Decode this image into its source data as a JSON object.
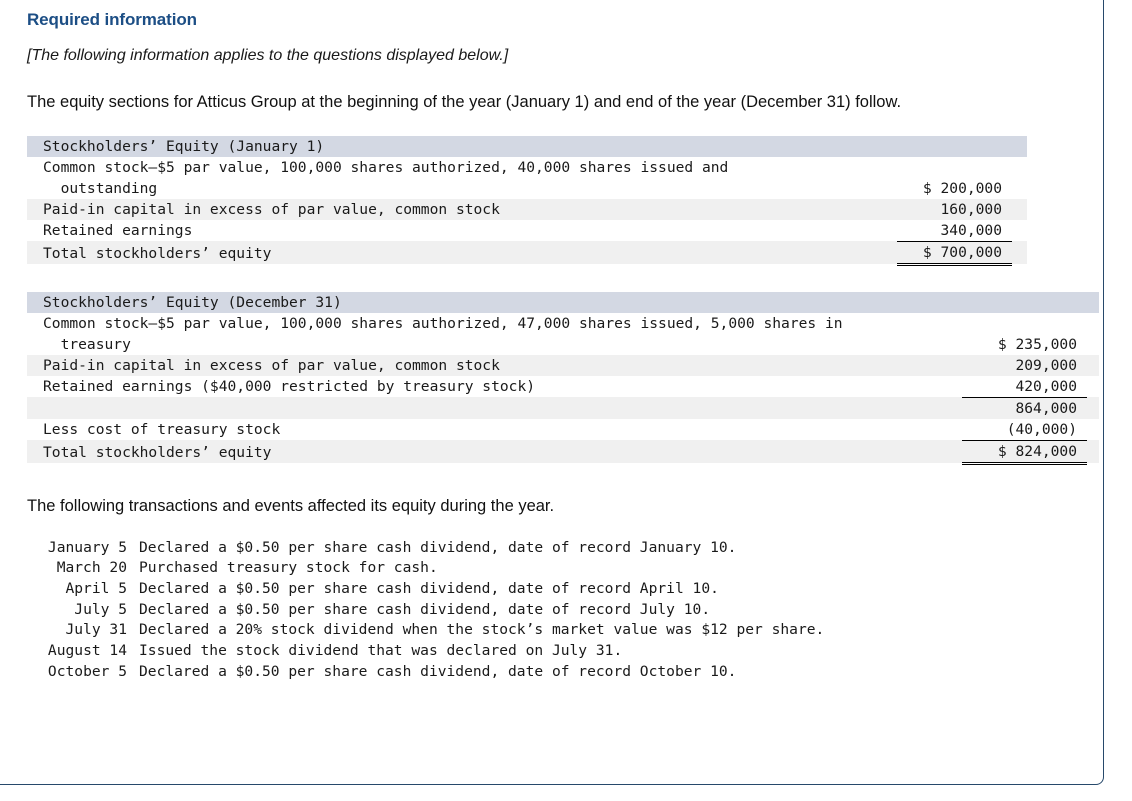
{
  "heading": "Required information",
  "italic_note": "[The following information applies to the questions displayed below.]",
  "intro_paragraph": "The equity sections for Atticus Group at the beginning of the year (January 1) and end of the year (December 31) follow.",
  "closing_paragraph": "The following transactions and events affected its equity during the year.",
  "colors": {
    "heading_blue": "#1c4e85",
    "table_header_band": "#d3d8e3",
    "row_shade": "#f0f0f0",
    "card_border": "#27496b"
  },
  "table_january": {
    "header": "Stockholders’ Equity (January 1)",
    "rows": [
      {
        "label": "Common stock—$5 par value, 100,000 shares authorized, 40,000 shares issued and",
        "value": ""
      },
      {
        "label": "  outstanding",
        "value": "$ 200,000"
      },
      {
        "label": "Paid-in capital in excess of par value, common stock",
        "value": "160,000"
      },
      {
        "label": "Retained earnings",
        "value": "340,000"
      },
      {
        "label": "Total stockholders’ equity",
        "value": "$ 700,000"
      }
    ]
  },
  "table_december": {
    "header": "Stockholders’ Equity (December 31)",
    "rows": [
      {
        "label": "Common stock—$5 par value, 100,000 shares authorized, 47,000 shares issued, 5,000 shares in",
        "value": ""
      },
      {
        "label": "  treasury",
        "value": "$ 235,000"
      },
      {
        "label": "Paid-in capital in excess of par value, common stock",
        "value": "209,000"
      },
      {
        "label": "Retained earnings ($40,000 restricted by treasury stock)",
        "value": "420,000"
      },
      {
        "label": "",
        "value": "864,000"
      },
      {
        "label": "Less cost of treasury stock",
        "value": "(40,000)"
      },
      {
        "label": "Total stockholders’ equity",
        "value": "$ 824,000"
      }
    ]
  },
  "transactions": [
    {
      "date": "January 5",
      "description": "Declared a $0.50 per share cash dividend, date of record January 10."
    },
    {
      "date": "March 20",
      "description": "Purchased treasury stock for cash."
    },
    {
      "date": "April 5",
      "description": "Declared a $0.50 per share cash dividend, date of record April 10."
    },
    {
      "date": "July 5",
      "description": "Declared a $0.50 per share cash dividend, date of record July 10."
    },
    {
      "date": "July 31",
      "description": "Declared a 20% stock dividend when the stock’s market value was $12 per share."
    },
    {
      "date": "August 14",
      "description": "Issued the stock dividend that was declared on July 31."
    },
    {
      "date": "October 5",
      "description": "Declared a $0.50 per share cash dividend, date of record October 10."
    }
  ]
}
